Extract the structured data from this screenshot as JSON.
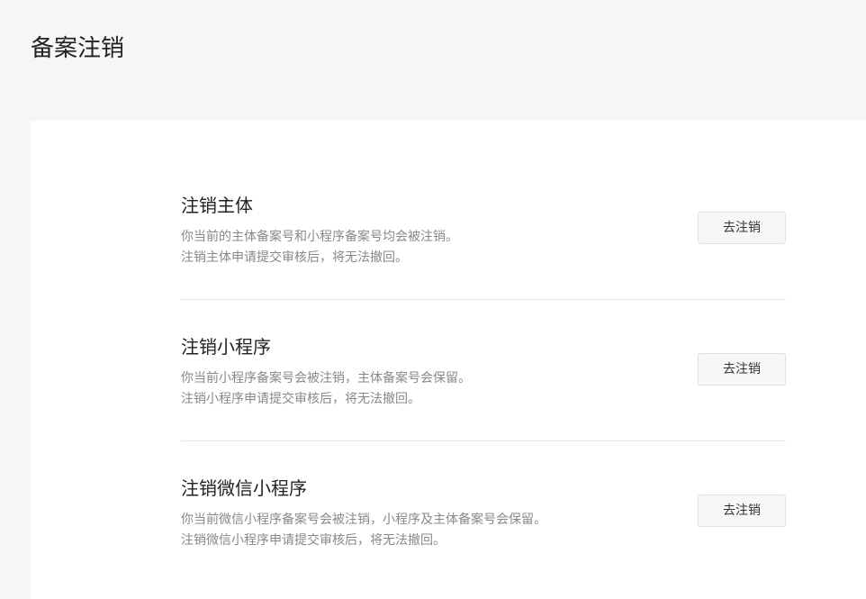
{
  "page": {
    "title": "备案注销"
  },
  "options": [
    {
      "title": "注销主体",
      "desc_line1": "你当前的主体备案号和小程序备案号均会被注销。",
      "desc_line2": "注销主体申请提交审核后，将无法撤回。",
      "button_label": "去注销"
    },
    {
      "title": "注销小程序",
      "desc_line1": "你当前小程序备案号会被注销，主体备案号会保留。",
      "desc_line2": "注销小程序申请提交审核后，将无法撤回。",
      "button_label": "去注销"
    },
    {
      "title": "注销微信小程序",
      "desc_line1": "你当前微信小程序备案号会被注销，小程序及主体备案号会保留。",
      "desc_line2": "注销微信小程序申请提交审核后，将无法撤回。",
      "button_label": "去注销"
    }
  ]
}
